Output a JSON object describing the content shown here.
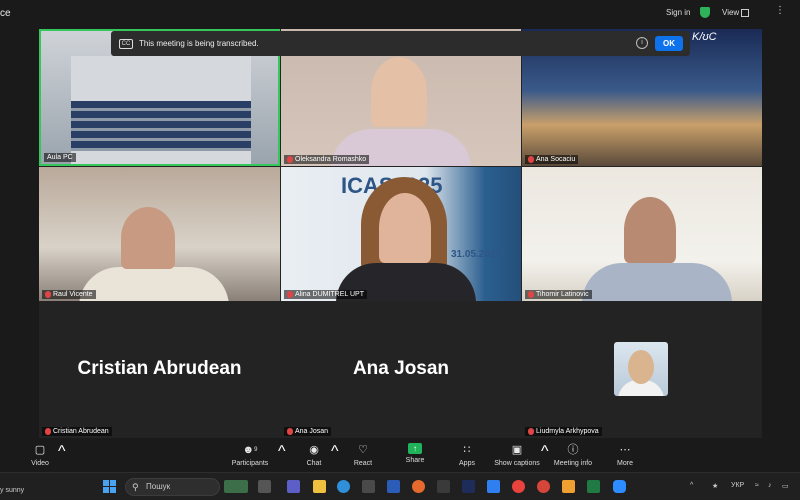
{
  "topbar": {
    "app_title_fragment": "ce",
    "sign_in_label": "Sign in",
    "view_label": "View",
    "more_label": "⋮"
  },
  "banner": {
    "cc_label": "CC",
    "text": "This meeting is being transcribed.",
    "info_label": "i",
    "ok_label": "OK"
  },
  "tiles": [
    {
      "name": "Aula PC",
      "muted": false
    },
    {
      "name": "Oleksandra Romashko",
      "muted": true
    },
    {
      "name": "Ana Socaciu",
      "muted": true
    },
    {
      "name": "Raul Vicente",
      "muted": true
    },
    {
      "name": "Alina DUMITREL UPT",
      "muted": true
    },
    {
      "name": "Tihomir Latinovic",
      "muted": true
    },
    {
      "name": "Cristian Abrudean",
      "muted": true,
      "big_name": "Cristian Abrudean"
    },
    {
      "name": "Ana Josan",
      "muted": true,
      "big_name": "Ana Josan"
    },
    {
      "name": "Liudmyla Arkhypova",
      "muted": true
    }
  ],
  "slide": {
    "title": "ICAS2025",
    "date": "31.05.2025"
  },
  "tile3_logo": "K/ʊC",
  "toolbar": {
    "video": "Video",
    "participants": "Participants",
    "participants_count": "9",
    "chat": "Chat",
    "react": "React",
    "share": "Share",
    "apps": "Apps",
    "captions": "Show captions",
    "meeting_info": "Meeting info",
    "more": "More"
  },
  "taskbar": {
    "weather": "y sunny",
    "search_placeholder": "Пошук",
    "language": "УКР"
  }
}
